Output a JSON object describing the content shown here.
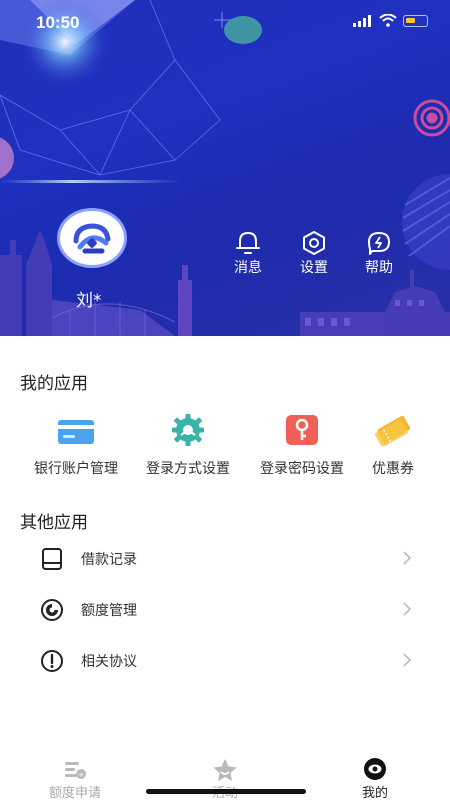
{
  "status_bar": {
    "time": "10:50"
  },
  "profile": {
    "username": "刘*"
  },
  "header_actions": [
    {
      "label": "消息",
      "icon": "bell-icon"
    },
    {
      "label": "设置",
      "icon": "settings-icon"
    },
    {
      "label": "帮助",
      "icon": "help-chat-icon"
    }
  ],
  "my_apps": {
    "title": "我的应用",
    "items": [
      {
        "label": "银行账户管理",
        "icon": "bank-card-icon",
        "color": "#4aa3ee"
      },
      {
        "label": "登录方式设置",
        "icon": "gear-icon",
        "color": "#3bb3a8"
      },
      {
        "label": "登录密码设置",
        "icon": "key-icon",
        "color": "#f06057"
      },
      {
        "label": "优惠券",
        "icon": "coupon-icon",
        "color": "#f5b52e"
      }
    ]
  },
  "other_apps": {
    "title": "其他应用",
    "items": [
      {
        "label": "借款记录",
        "icon": "record-icon"
      },
      {
        "label": "额度管理",
        "icon": "quota-icon"
      },
      {
        "label": "相关协议",
        "icon": "agreement-icon"
      }
    ]
  },
  "tab_bar": {
    "tabs": [
      {
        "label": "额度申请",
        "icon": "quota-apply-icon",
        "active": false
      },
      {
        "label": "活动",
        "icon": "star-activity-icon",
        "active": false
      },
      {
        "label": "我的",
        "icon": "profile-eye-icon",
        "active": true
      }
    ]
  },
  "colors": {
    "header_blue": "#1f2fb8",
    "active_tab": "#222222",
    "inactive_tab": "#aaaaaa"
  }
}
